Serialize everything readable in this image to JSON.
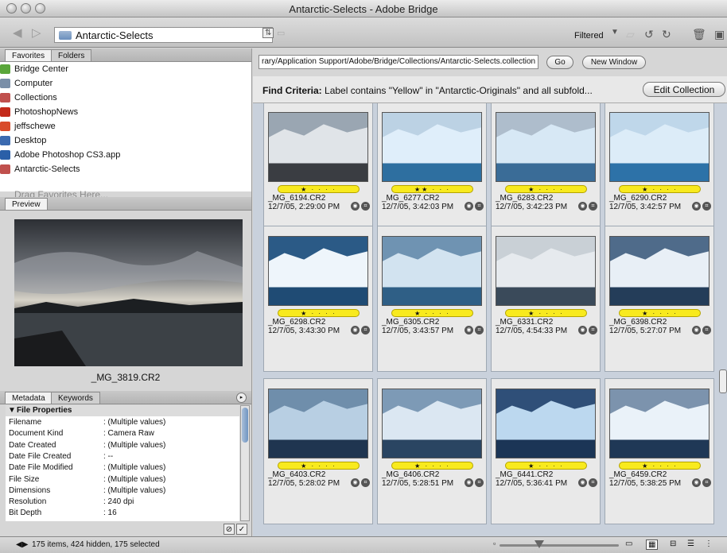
{
  "window": {
    "title": "Antarctic-Selects - Adobe Bridge"
  },
  "toolbar": {
    "path_label": "Antarctic-Selects",
    "filtered_label": "Filtered"
  },
  "left": {
    "tabs": [
      "Favorites",
      "Folders"
    ],
    "favorites": [
      {
        "label": "Bridge Center",
        "color": "#5aa63a"
      },
      {
        "label": "Computer",
        "color": "#7a8fa8"
      },
      {
        "label": "Collections",
        "color": "#c0504d"
      },
      {
        "label": "PhotoshopNews",
        "color": "#c42a1a"
      },
      {
        "label": "jeffschewe",
        "color": "#d84b2a"
      },
      {
        "label": "Desktop",
        "color": "#3b6ab0"
      },
      {
        "label": "Adobe Photoshop CS3.app",
        "color": "#2a5fa8"
      },
      {
        "label": "Antarctic-Selects",
        "color": "#c0504d"
      }
    ],
    "drag_hint": "Drag Favorites Here...",
    "preview_tab": "Preview",
    "preview_filename": "_MG_3819.CR2",
    "meta_tabs": [
      "Metadata",
      "Keywords"
    ],
    "file_properties_label": "File Properties",
    "metadata": [
      {
        "key": "Filename",
        "value": ": (Multiple values)"
      },
      {
        "key": "Document Kind",
        "value": ": Camera Raw"
      },
      {
        "key": "Date Created",
        "value": ": (Multiple values)"
      },
      {
        "key": "Date File Created",
        "value": ": --"
      },
      {
        "key": "Date File Modified",
        "value": ": (Multiple values)"
      },
      {
        "key": "File Size",
        "value": ": (Multiple values)"
      },
      {
        "key": "Dimensions",
        "value": ": (Multiple values)"
      },
      {
        "key": "Resolution",
        "value": ": 240 dpi"
      },
      {
        "key": "Bit Depth",
        "value": ": 16"
      }
    ]
  },
  "address": {
    "path": "rary/Application Support/Adobe/Bridge/Collections/Antarctic-Selects.collection",
    "go_label": "Go",
    "new_window_label": "New Window"
  },
  "find": {
    "prefix": "Find Criteria:",
    "criteria": "Label contains \"Yellow\" in \"Antarctic-Originals\" and all subfold...",
    "edit_label": "Edit Collection"
  },
  "thumbnails": [
    {
      "filename": "_MG_6194.CR2",
      "date": "12/7/05, 2:29:00 PM",
      "stars": "★ · · · ·",
      "sky": "#9aa6b2",
      "sea": "#3a3d42",
      "ice": "#e0e4e8"
    },
    {
      "filename": "_MG_6277.CR2",
      "date": "12/7/05, 3:42:03 PM",
      "stars": "★★ · · ·",
      "sky": "#bcd2e4",
      "sea": "#2e6fa0",
      "ice": "#dfeefa"
    },
    {
      "filename": "_MG_6283.CR2",
      "date": "12/7/05, 3:42:23 PM",
      "stars": "★ · · · ·",
      "sky": "#aebdcc",
      "sea": "#3a6c97",
      "ice": "#d7e8f5"
    },
    {
      "filename": "_MG_6290.CR2",
      "date": "12/7/05, 3:42:57 PM",
      "stars": "★ · · · ·",
      "sky": "#bfd7ea",
      "sea": "#2d72a8",
      "ice": "#dcecf8"
    },
    {
      "filename": "_MG_6298.CR2",
      "date": "12/7/05, 3:43:30 PM",
      "stars": "★ · · · ·",
      "sky": "#2b5a86",
      "sea": "#1f4b74",
      "ice": "#eef5fb"
    },
    {
      "filename": "_MG_6305.CR2",
      "date": "12/7/05, 3:43:57 PM",
      "stars": "★ · · · ·",
      "sky": "#6f93b2",
      "sea": "#2f5f86",
      "ice": "#d2e3f0"
    },
    {
      "filename": "_MG_6331.CR2",
      "date": "12/7/05, 4:54:33 PM",
      "stars": "★ · · · ·",
      "sky": "#c9d0d6",
      "sea": "#3a4a5a",
      "ice": "#e6eaee"
    },
    {
      "filename": "_MG_6398.CR2",
      "date": "12/7/05, 5:27:07 PM",
      "stars": "★ · · · ·",
      "sky": "#4f6b8a",
      "sea": "#243d59",
      "ice": "#e8eff6"
    },
    {
      "filename": "_MG_6403.CR2",
      "date": "12/7/05, 5:28:02 PM",
      "stars": "★ · · · ·",
      "sky": "#6f8eab",
      "sea": "#1f3550",
      "ice": "#b8cfe3"
    },
    {
      "filename": "_MG_6406.CR2",
      "date": "12/7/05, 5:28:51 PM",
      "stars": "★ · · · ·",
      "sky": "#7d9ab6",
      "sea": "#2a4562",
      "ice": "#dbe7f2"
    },
    {
      "filename": "_MG_6441.CR2",
      "date": "12/7/05, 5:36:41 PM",
      "stars": "★ · · · ·",
      "sky": "#2f4f78",
      "sea": "#1b3556",
      "ice": "#bcd8ef"
    },
    {
      "filename": "_MG_6459.CR2",
      "date": "12/7/05, 5:38:25 PM",
      "stars": "★ · · · ·",
      "sky": "#7c93ad",
      "sea": "#1f3856",
      "ice": "#eaf2f9"
    }
  ],
  "status": {
    "text": "175 items, 424 hidden, 175 selected"
  }
}
